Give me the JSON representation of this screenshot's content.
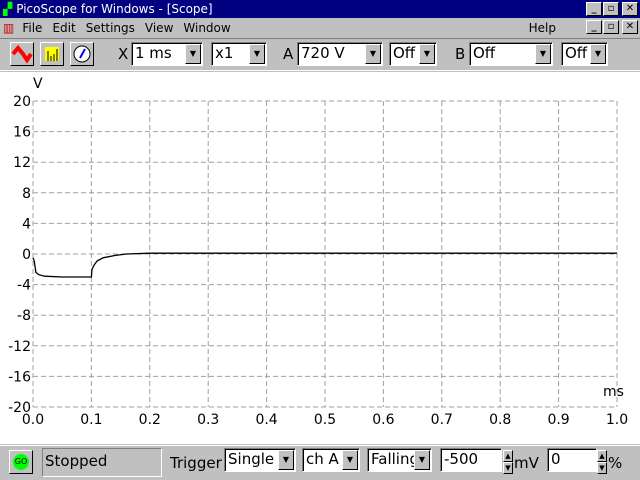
{
  "window": {
    "title": "PicoScope for Windows - [Scope]"
  },
  "menu": {
    "items": [
      "File",
      "Edit",
      "Settings",
      "View",
      "Window"
    ],
    "help": "Help"
  },
  "toolbar": {
    "x_label": "X",
    "timebase": "1 ms",
    "multiplier": "x1",
    "a_label": "A",
    "a_range": "720 V",
    "a_coupling": "Off",
    "b_label": "B",
    "b_range": "Off",
    "b_coupling": "Off"
  },
  "status": {
    "go_label": "GO",
    "state": "Stopped",
    "trigger_label": "Trigger",
    "trigger_mode": "Single",
    "trigger_channel": "ch A",
    "trigger_edge": "Falling",
    "trigger_level": "-500",
    "level_unit": "mV",
    "delay": "0",
    "delay_unit": "%"
  },
  "colors": {
    "trace": "#000000",
    "grid": "#a0a0a0",
    "title_bar": "#000080"
  },
  "chart_data": {
    "type": "line",
    "ylabel": "V",
    "xlabel": "ms",
    "xlim": [
      0,
      1
    ],
    "ylim": [
      -20,
      20
    ],
    "x_ticks": [
      "0.0",
      "0.1",
      "0.2",
      "0.3",
      "0.4",
      "0.5",
      "0.6",
      "0.7",
      "0.8",
      "0.9",
      "1.0"
    ],
    "y_ticks": [
      "20",
      "16",
      "12",
      "8",
      "4",
      "0",
      "-4",
      "-8",
      "-12",
      "-16",
      "-20"
    ],
    "series": [
      {
        "name": "A",
        "x": [
          0,
          0.002,
          0.005,
          0.01,
          0.02,
          0.05,
          0.1,
          0.101,
          0.105,
          0.11,
          0.12,
          0.14,
          0.16,
          0.2,
          0.3,
          0.5,
          0.7,
          1.0
        ],
        "y": [
          -0.5,
          -0.9,
          -2.4,
          -2.7,
          -2.9,
          -3.0,
          -3.0,
          -2.0,
          -1.4,
          -0.9,
          -0.5,
          -0.2,
          0.0,
          0.1,
          0.1,
          0.1,
          0.1,
          0.1
        ]
      }
    ]
  }
}
